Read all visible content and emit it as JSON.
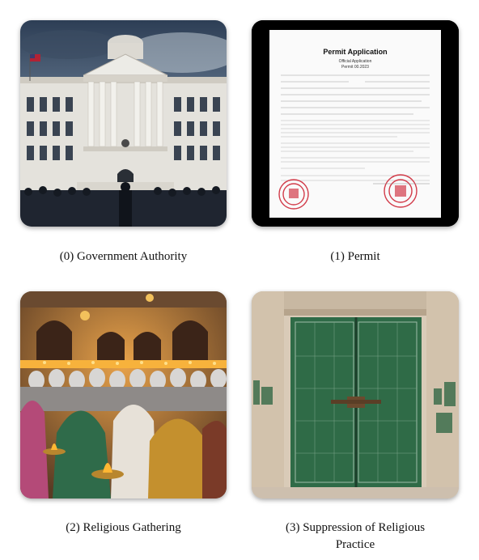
{
  "panels": [
    {
      "index": "(0)",
      "caption": "(0) Government Authority",
      "image": "government-building"
    },
    {
      "index": "(1)",
      "caption": "(1) Permit",
      "image": "permit-document"
    },
    {
      "index": "(2)",
      "caption": "(2) Religious Gathering",
      "image": "religious-gathering"
    },
    {
      "index": "(3)",
      "caption_line1": "(3) Suppression of Religious",
      "caption_line2": "Practice",
      "image": "closed-door"
    }
  ],
  "permit": {
    "title": "Permit Application",
    "subtitle1": "Official Application",
    "subtitle2": "Permit 00.2023"
  }
}
